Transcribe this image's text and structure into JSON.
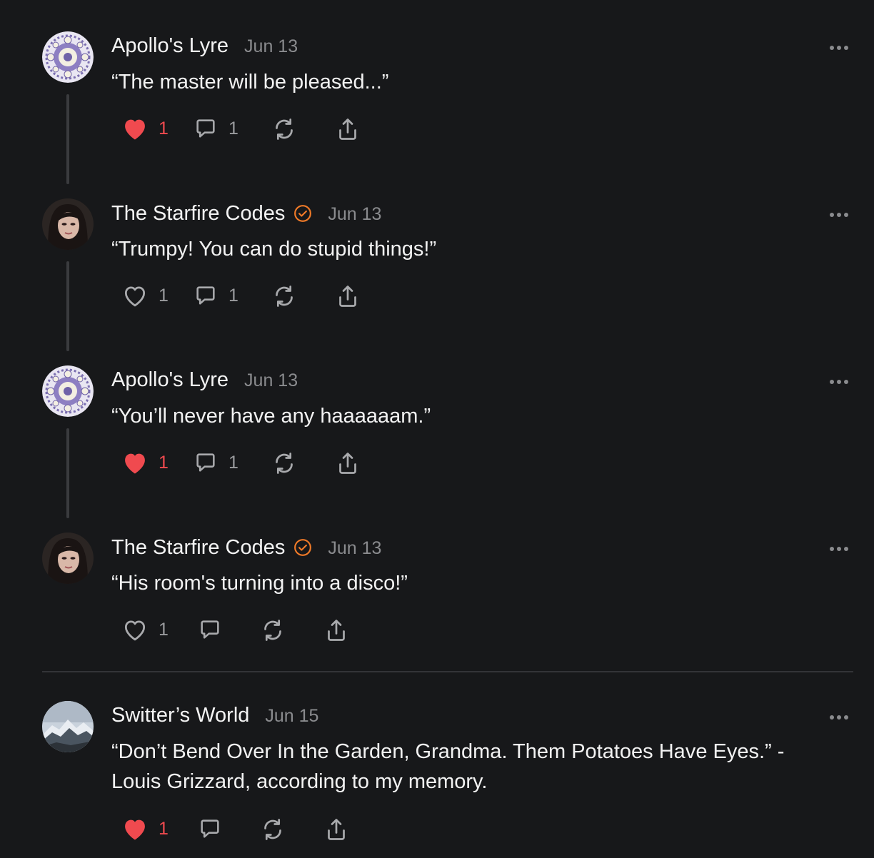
{
  "posts": [
    {
      "author": "Apollo's Lyre",
      "verified": false,
      "date": "Jun 13",
      "text": "“The master will be pleased...”",
      "avatar": "apollo-lyre-avatar",
      "liked": true,
      "likes": "1",
      "comments": "1",
      "thread_continues": true
    },
    {
      "author": "The Starfire Codes",
      "verified": true,
      "date": "Jun 13",
      "text": "“Trumpy! You can do stupid things!”",
      "avatar": "starfire-codes-avatar",
      "liked": false,
      "likes": "1",
      "comments": "1",
      "thread_continues": true
    },
    {
      "author": "Apollo's Lyre",
      "verified": false,
      "date": "Jun 13",
      "text": "“You’ll never have any haaaaaam.”",
      "avatar": "apollo-lyre-avatar",
      "liked": true,
      "likes": "1",
      "comments": "1",
      "thread_continues": true
    },
    {
      "author": "The Starfire Codes",
      "verified": true,
      "date": "Jun 13",
      "text": "“His room's turning into a disco!”",
      "avatar": "starfire-codes-avatar",
      "liked": false,
      "likes": "1",
      "comments": "",
      "thread_continues": false
    },
    {
      "author": "Switter’s World",
      "verified": false,
      "date": "Jun 15",
      "text": "“Don’t Bend Over In the Garden, Grandma. Them Potatoes Have Eyes.” - Louis Grizzard, according to my memory.",
      "avatar": "switters-world-avatar",
      "liked": true,
      "likes": "1",
      "comments": "",
      "thread_continues": false
    }
  ],
  "colors": {
    "background": "#17181a",
    "like_active": "#f04a4f",
    "verified_badge": "#f07a28",
    "muted": "#8a8b8e"
  }
}
